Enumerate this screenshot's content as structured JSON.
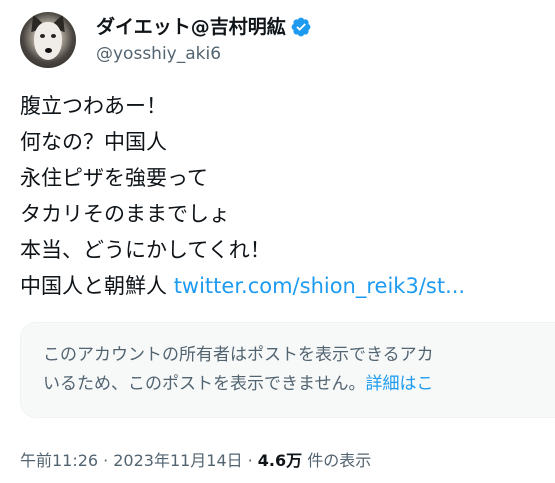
{
  "author": {
    "display_name": "ダイエット@吉村明紘",
    "handle": "@yosshiy_aki6",
    "verified": true,
    "avatar_icon": "husky-dog-avatar",
    "verified_color": "#1d9bf0"
  },
  "tweet": {
    "lines": [
      "腹立つわあー！",
      "何なの？中国人",
      "永住ピザを強要って",
      "タカリそのままでしょ",
      "本当、どうにかしてくれ！"
    ],
    "last_line_text": "中国人と朝鮮人 ",
    "last_line_link": "twitter.com/shion_reik3/st..."
  },
  "unavailable_quote": {
    "line1": "このアカウントの所有者はポストを表示できるアカ",
    "line2_text": "いるため、このポストを表示できません。",
    "line2_link": "詳細はこ"
  },
  "meta": {
    "time": "午前11:26",
    "separator": "·",
    "date": "2023年11月14日",
    "views_count": "4.6万",
    "views_label": " 件の表示"
  },
  "colors": {
    "link": "#1d9bf0",
    "secondary_text": "#536471",
    "primary_text": "#0f1419",
    "quote_background": "#f7f9f9"
  }
}
